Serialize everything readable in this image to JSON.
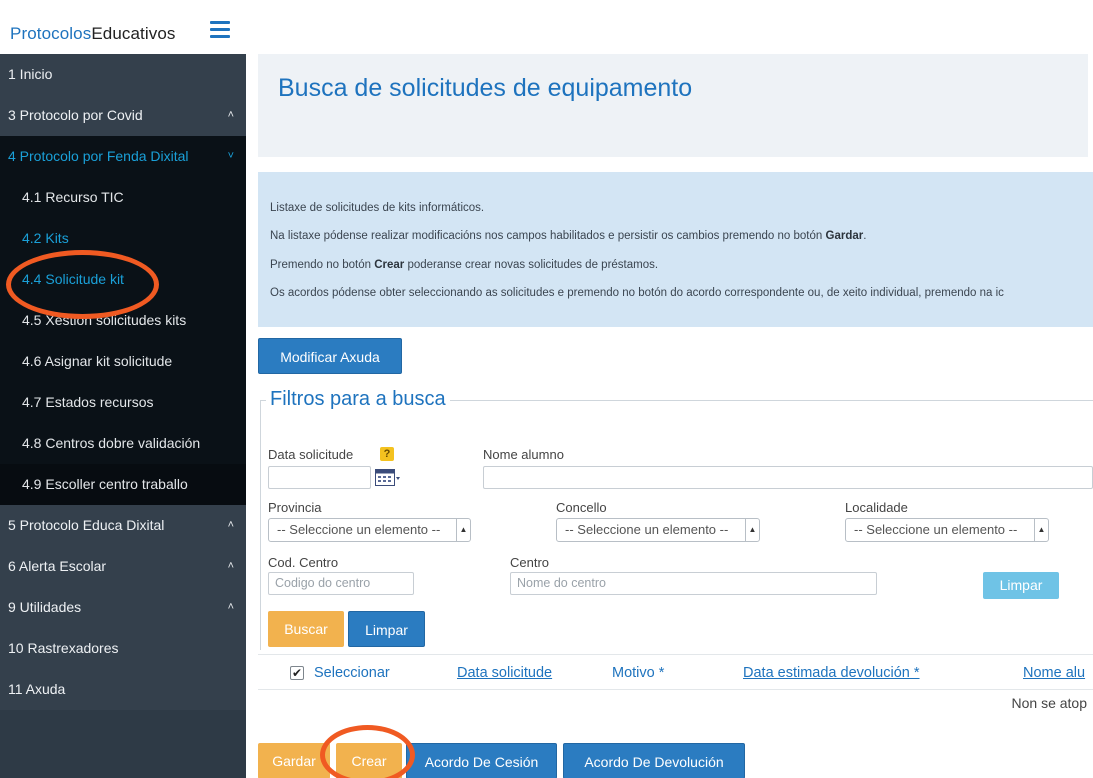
{
  "brand": {
    "part1": "Protocolos",
    "part2": "Educativos"
  },
  "sidebar": {
    "items": [
      {
        "label": "1 Inicio"
      },
      {
        "label": "3 Protocolo por Covid",
        "chevron": "^"
      },
      {
        "label": "4 Protocolo por Fenda Dixital",
        "chevron": "v"
      },
      {
        "label": "4.1 Recurso TIC"
      },
      {
        "label": "4.2 Kits"
      },
      {
        "label": "4.4 Solicitude kit"
      },
      {
        "label": "4.5 Xestión solicitudes kits"
      },
      {
        "label": "4.6 Asignar kit solicitude"
      },
      {
        "label": "4.7 Estados recursos"
      },
      {
        "label": "4.8 Centros dobre validación"
      },
      {
        "label": "4.9 Escoller centro traballo"
      },
      {
        "label": "5 Protocolo Educa Dixital",
        "chevron": "^"
      },
      {
        "label": "6 Alerta Escolar",
        "chevron": "^"
      },
      {
        "label": "9 Utilidades",
        "chevron": "^"
      },
      {
        "label": "10 Rastrexadores"
      },
      {
        "label": "11 Axuda"
      }
    ]
  },
  "page": {
    "title": "Busca de solicitudes de equipamento"
  },
  "info": {
    "line1": "Listaxe de solicitudes de kits informáticos.",
    "line2_pre": "Na listaxe pódense realizar modificacións nos campos habilitados e persistir os cambios premendo no botón ",
    "line2_bold": "Gardar",
    "line2_post": ".",
    "line3_pre": "Premendo no botón ",
    "line3_bold": "Crear",
    "line3_post": " poderanse crear novas solicitudes de préstamos.",
    "line4": "Os acordos pódense obter seleccionando as solicitudes e premendo no botón do acordo correspondente ou, de xeito individual, premendo na ic"
  },
  "buttons": {
    "modify_help": "Modificar Axuda",
    "clear_inline": "Limpar",
    "search": "Buscar",
    "clear": "Limpar",
    "save": "Gardar",
    "create": "Crear",
    "cession_agreement": "Acordo De Cesión",
    "return_agreement": "Acordo De Devolución"
  },
  "filters": {
    "legend": "Filtros para a busca",
    "request_date_label": "Data solicitude",
    "help_mark": "?",
    "student_name_label": "Nome alumno",
    "province_label": "Provincia",
    "province_value": "-- Seleccione un elemento --",
    "council_label": "Concello",
    "council_value": "-- Seleccione un elemento --",
    "locality_label": "Localidade",
    "locality_value": "-- Seleccione un elemento --",
    "center_code_label": "Cod. Centro",
    "center_code_placeholder": "Codigo do centro",
    "center_label": "Centro",
    "center_placeholder": "Nome do centro"
  },
  "table": {
    "select_all": "Seleccionar",
    "check_mark": "✔",
    "columns": [
      "Data solicitude",
      "Motivo *",
      "Data estimada devolución *",
      "Nome alu"
    ],
    "empty_message": "Non se atop"
  },
  "colors": {
    "accent": "#1e73be",
    "annotation": "#f05a22",
    "button_orange": "#f2b24e",
    "button_blue": "#2b7cc1"
  }
}
